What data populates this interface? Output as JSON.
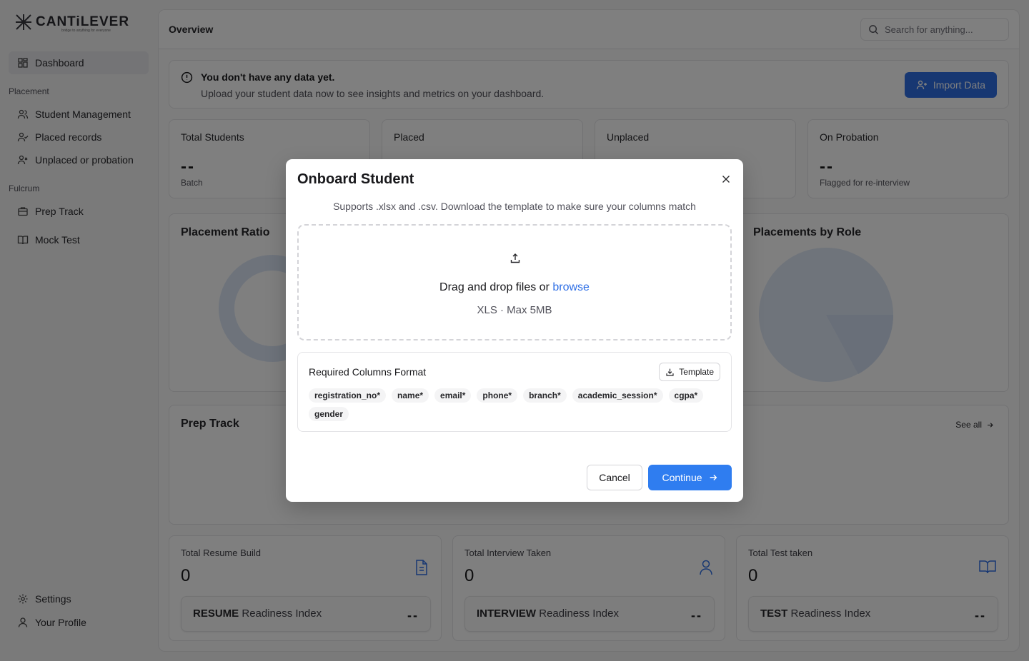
{
  "brand": {
    "name": "CANTiLEVER",
    "tagline": "bridge to anything for everyone"
  },
  "sidebar": {
    "dashboard": "Dashboard",
    "groups": [
      {
        "label": "Placement",
        "items": [
          "Student Management",
          "Placed records",
          "Unplaced or probation"
        ]
      },
      {
        "label": "Fulcrum",
        "items": [
          "Prep Track",
          "Mock Test"
        ]
      }
    ],
    "footer": [
      "Settings",
      "Your Profile"
    ]
  },
  "header": {
    "title": "Overview",
    "search_placeholder": "Search for anything..."
  },
  "alert": {
    "title": "You don't have any data yet.",
    "body": "Upload your student data now to see insights and metrics on your dashboard.",
    "button": "Import Data"
  },
  "stats": [
    {
      "label": "Total Students",
      "value": "--",
      "sub": "Batch"
    },
    {
      "label": "Placed",
      "value": "",
      "sub": ""
    },
    {
      "label": "Unplaced",
      "value": "",
      "sub": ""
    },
    {
      "label": "On Probation",
      "value": "--",
      "sub": "Flagged for re-interview"
    }
  ],
  "sections": {
    "placement_ratio": "Placement Ratio",
    "placements_by_role": "Placements by Role",
    "prep_track": "Prep Track",
    "see_all": "See all"
  },
  "metrics": [
    {
      "title": "Total Resume Build",
      "value": "0",
      "icon": "document-icon",
      "readiness_bold": "RESUME",
      "readiness_rest": " Readiness Index",
      "readiness_value": "--"
    },
    {
      "title": "Total Interview Taken",
      "value": "0",
      "icon": "user-icon",
      "readiness_bold": "INTERVIEW",
      "readiness_rest": " Readiness Index",
      "readiness_value": "--"
    },
    {
      "title": "Total Test taken",
      "value": "0",
      "icon": "book-icon",
      "readiness_bold": "TEST",
      "readiness_rest": " Readiness Index",
      "readiness_value": "--"
    }
  ],
  "modal": {
    "title": "Onboard Student",
    "description": "Supports .xlsx and .csv. Download the template to make sure your columns match",
    "drop_text": "Drag and drop files or ",
    "browse": "browse",
    "drop_sub": "XLS · Max 5MB",
    "columns_title": "Required Columns Format",
    "template_button": "Template",
    "columns": [
      "registration_no*",
      "name*",
      "email*",
      "phone*",
      "branch*",
      "academic_session*",
      "cgpa*",
      "gender"
    ],
    "cancel": "Cancel",
    "continue": "Continue"
  },
  "colors": {
    "accent": "#2f6fe5",
    "continue": "#2f7df0"
  }
}
